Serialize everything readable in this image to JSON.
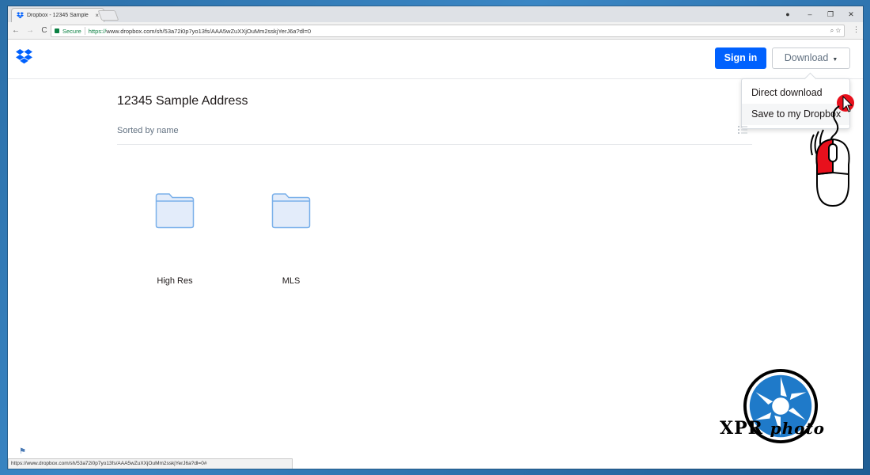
{
  "browser": {
    "tab_title": "Dropbox - 12345 Sample",
    "tab_close": "×",
    "window_controls": [
      "●",
      "–",
      "❐",
      "✕"
    ],
    "nav": {
      "back": "←",
      "forward": "→",
      "reload": "C"
    },
    "secure_label": "Secure",
    "url_scheme": "https://",
    "url_rest": "www.dropbox.com/sh/53a72i0p7yo13fs/AAA5wZuXXjOuMm2sskjYerJ6a?dl=0",
    "omni_icons": "⌕ ☆",
    "menu_dots": "⋮",
    "status_url": "https://www.dropbox.com/sh/53a72i0p7yo13fs/AAA5wZuXXjOuMm2sskjYerJ6a?dl=0#"
  },
  "header": {
    "signin_label": "Sign in",
    "download_label": "Download",
    "download_caret": "▼"
  },
  "dropdown": {
    "items": [
      {
        "label": "Direct download"
      },
      {
        "label": "Save to my Dropbox"
      }
    ]
  },
  "main": {
    "folder_title": "12345 Sample Address",
    "sorted_label": "Sorted by name",
    "folders": [
      {
        "name": "High Res"
      },
      {
        "name": "MLS"
      }
    ]
  },
  "watermark": {
    "brand": "XPR",
    "sub": "photo"
  },
  "colors": {
    "primary": "#0061fe",
    "folder_fill": "#e3ecfa",
    "folder_stroke": "#7ab0ea",
    "mouse_red": "#e8101c"
  }
}
